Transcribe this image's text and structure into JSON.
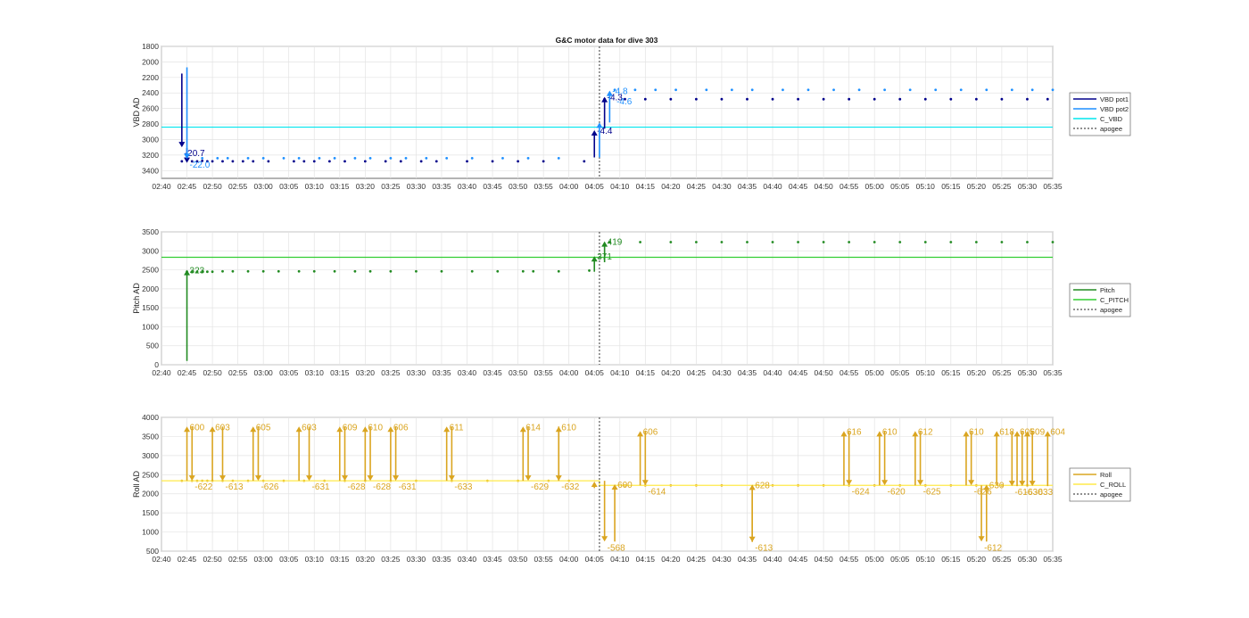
{
  "figure_title": "G&C motor data for dive 303",
  "colors": {
    "vbd_pot1": "#00008b",
    "vbd_pot2": "#1e90ff",
    "c_vbd": "#00e5ee",
    "pitch": "#228b22",
    "c_pitch": "#32cd32",
    "roll": "#daa520",
    "c_roll": "#ffea4a",
    "apogee": "#222222",
    "grid": "#e3e3e3"
  },
  "x_tick_labels": [
    "02:40",
    "02:45",
    "02:50",
    "02:55",
    "03:00",
    "03:05",
    "03:10",
    "03:15",
    "03:20",
    "03:25",
    "03:30",
    "03:35",
    "03:40",
    "03:45",
    "03:50",
    "03:55",
    "04:00",
    "04:05",
    "04:10",
    "04:15",
    "04:20",
    "04:25",
    "04:30",
    "04:35",
    "04:40",
    "04:45",
    "04:50",
    "04:55",
    "05:00",
    "05:05",
    "05:10",
    "05:15",
    "05:20",
    "05:25",
    "05:30",
    "05:35"
  ],
  "chart_data": [
    {
      "type": "line",
      "title": "G&C motor data for dive 303",
      "ylabel": "VBD AD",
      "xlim": [
        "02:40",
        "05:35"
      ],
      "ylim": [
        1800,
        3500
      ],
      "y_reversed": true,
      "yticks": [
        1800,
        2000,
        2200,
        2400,
        2600,
        2800,
        3000,
        3200,
        3400
      ],
      "legend_position": "right",
      "legend": [
        "VBD pot1",
        "VBD pot2",
        "C_VBD",
        "apogee"
      ],
      "series": [
        {
          "name": "VBD pot1",
          "values_x": [
            "02:44",
            "02:46",
            "02:47",
            "02:48",
            "02:49",
            "02:50",
            "02:52",
            "02:54",
            "02:56",
            "02:58",
            "03:01",
            "03:06",
            "03:08",
            "03:10",
            "03:13",
            "03:16",
            "03:20",
            "03:24",
            "03:27",
            "03:31",
            "03:34",
            "03:40",
            "03:45",
            "03:50",
            "03:55",
            "04:03",
            "04:07",
            "04:11",
            "04:15",
            "04:20",
            "04:25",
            "04:30",
            "04:35",
            "04:40",
            "04:45",
            "04:50",
            "04:55",
            "05:00",
            "05:05",
            "05:10",
            "05:15",
            "05:20",
            "05:25",
            "05:30",
            "05:34"
          ],
          "values": [
            3280,
            3280,
            3280,
            3275,
            3280,
            3280,
            3280,
            3280,
            3280,
            3280,
            3280,
            3280,
            3280,
            3280,
            3280,
            3280,
            3280,
            3280,
            3280,
            3280,
            3280,
            3280,
            3280,
            3280,
            3280,
            3280,
            2480,
            2480,
            2480,
            2480,
            2480,
            2480,
            2480,
            2480,
            2480,
            2480,
            2480,
            2480,
            2480,
            2480,
            2480,
            2480,
            2480,
            2480,
            2480
          ]
        },
        {
          "name": "VBD pot2",
          "values_x": [
            "02:45",
            "02:48",
            "02:51",
            "02:53",
            "02:57",
            "03:00",
            "03:04",
            "03:07",
            "03:11",
            "03:14",
            "03:18",
            "03:21",
            "03:25",
            "03:28",
            "03:32",
            "03:36",
            "03:41",
            "03:47",
            "03:52",
            "03:58",
            "04:09",
            "04:13",
            "04:17",
            "04:21",
            "04:27",
            "04:32",
            "04:36",
            "04:42",
            "04:47",
            "04:52",
            "04:57",
            "05:02",
            "05:07",
            "05:12",
            "05:17",
            "05:22",
            "05:27",
            "05:31",
            "05:35"
          ],
          "values": [
            3240,
            3240,
            3240,
            3240,
            3240,
            3240,
            3240,
            3240,
            3240,
            3240,
            3240,
            3240,
            3240,
            3240,
            3240,
            3240,
            3240,
            3240,
            3240,
            3240,
            2360,
            2360,
            2360,
            2360,
            2360,
            2360,
            2360,
            2360,
            2360,
            2360,
            2360,
            2360,
            2360,
            2360,
            2360,
            2360,
            2360,
            2360,
            2360
          ]
        },
        {
          "name": "C_VBD",
          "constant": 2840
        }
      ],
      "arrows": [
        {
          "series": "VBD pot1",
          "x": "02:44",
          "from": 2150,
          "to": 3100,
          "label": "-20.7"
        },
        {
          "series": "VBD pot1",
          "x": "02:45",
          "from": 3110,
          "to": 3300,
          "label": ""
        },
        {
          "series": "VBD pot2",
          "x": "02:45",
          "from": 2070,
          "to": 3250,
          "label": "-22.0"
        },
        {
          "series": "VBD pot1",
          "x": "04:05",
          "from": 3230,
          "to": 2880,
          "label": "-4.4"
        },
        {
          "series": "VBD pot1",
          "x": "04:07",
          "from": 2860,
          "to": 2450,
          "label": "-4.3"
        },
        {
          "series": "VBD pot2",
          "x": "04:06",
          "from": 3230,
          "to": 2780,
          "label": ""
        },
        {
          "series": "VBD pot2",
          "x": "04:08",
          "from": 2780,
          "to": 2370,
          "label": "-4.8"
        }
      ],
      "annotations": [
        {
          "text": "-4.6",
          "x": "04:09",
          "y": 2500
        }
      ],
      "apogee": "04:06"
    },
    {
      "type": "line",
      "ylabel": "Pitch AD",
      "xlim": [
        "02:40",
        "05:35"
      ],
      "ylim": [
        0,
        3500
      ],
      "yticks": [
        0,
        500,
        1000,
        1500,
        2000,
        2500,
        3000,
        3500
      ],
      "legend_position": "right",
      "legend": [
        "Pitch",
        "C_PITCH",
        "apogee"
      ],
      "series": [
        {
          "name": "Pitch",
          "values_x": [
            "02:45",
            "02:46",
            "02:47",
            "02:48",
            "02:49",
            "02:50",
            "02:52",
            "02:54",
            "02:57",
            "03:00",
            "03:03",
            "03:07",
            "03:10",
            "03:14",
            "03:18",
            "03:21",
            "03:25",
            "03:30",
            "03:35",
            "03:41",
            "03:46",
            "03:51",
            "03:53",
            "03:58",
            "04:04",
            "04:08",
            "04:14",
            "04:20",
            "04:25",
            "04:30",
            "04:35",
            "04:40",
            "04:45",
            "04:50",
            "04:55",
            "05:00",
            "05:05",
            "05:10",
            "05:15",
            "05:20",
            "05:25",
            "05:30",
            "05:35"
          ],
          "values": [
            2450,
            2450,
            2450,
            2450,
            2450,
            2450,
            2460,
            2460,
            2460,
            2460,
            2460,
            2460,
            2460,
            2460,
            2460,
            2460,
            2460,
            2460,
            2460,
            2460,
            2460,
            2460,
            2460,
            2460,
            2480,
            3230,
            3230,
            3230,
            3230,
            3230,
            3230,
            3230,
            3230,
            3230,
            3230,
            3230,
            3230,
            3230,
            3230,
            3230,
            3230,
            3230,
            3230
          ]
        },
        {
          "name": "C_PITCH",
          "constant": 2830
        }
      ],
      "arrows": [
        {
          "series": "Pitch",
          "x": "02:45",
          "from": 100,
          "to": 2500,
          "label": "323"
        },
        {
          "series": "Pitch",
          "x": "04:05",
          "from": 2450,
          "to": 2860,
          "label": "371"
        },
        {
          "series": "Pitch",
          "x": "04:07",
          "from": 2700,
          "to": 3250,
          "label": "419"
        }
      ],
      "apogee": "04:06"
    },
    {
      "type": "line",
      "ylabel": "Roll AD",
      "xlim": [
        "02:40",
        "05:35"
      ],
      "ylim": [
        500,
        4000
      ],
      "yticks": [
        500,
        1000,
        1500,
        2000,
        2500,
        3000,
        3500,
        4000
      ],
      "legend_position": "right",
      "legend": [
        "Roll",
        "C_ROLL",
        "apogee"
      ],
      "series": [
        {
          "name": "Roll",
          "values_x": [
            "02:44",
            "02:46",
            "02:47",
            "02:48",
            "02:49",
            "02:50",
            "02:52",
            "02:54",
            "02:57",
            "03:00",
            "03:04",
            "03:08",
            "03:12",
            "03:16",
            "03:20",
            "03:25",
            "03:30",
            "03:37",
            "03:44",
            "03:50",
            "03:56",
            "04:00",
            "04:11",
            "04:15",
            "04:20",
            "04:25",
            "04:30",
            "04:40",
            "04:45",
            "04:50",
            "04:55",
            "05:00",
            "05:05",
            "05:10",
            "05:15",
            "05:20",
            "05:25",
            "05:30"
          ],
          "values": [
            2340,
            2340,
            2340,
            2340,
            2340,
            2340,
            2340,
            2340,
            2340,
            2340,
            2340,
            2340,
            2340,
            2340,
            2340,
            2340,
            2340,
            2340,
            2340,
            2340,
            2340,
            2340,
            2220,
            2220,
            2220,
            2220,
            2220,
            2220,
            2220,
            2220,
            2220,
            2220,
            2220,
            2220,
            2220,
            2220,
            2220,
            2220
          ]
        },
        {
          "name": "C_ROLL",
          "values_x": [
            "02:40",
            "04:06",
            "04:06",
            "05:35"
          ],
          "values": [
            2340,
            2340,
            2220,
            2220
          ]
        }
      ],
      "arrows": [
        {
          "x": "02:45",
          "from": 2340,
          "to": 3760,
          "label": "600"
        },
        {
          "x": "02:46",
          "from": 3760,
          "to": 2340,
          "label": "-622"
        },
        {
          "x": "02:50",
          "from": 2340,
          "to": 3760,
          "label": "603"
        },
        {
          "x": "02:52",
          "from": 3760,
          "to": 2340,
          "label": "-613"
        },
        {
          "x": "02:58",
          "from": 2340,
          "to": 3760,
          "label": "605"
        },
        {
          "x": "02:59",
          "from": 3760,
          "to": 2340,
          "label": "-626"
        },
        {
          "x": "03:07",
          "from": 2340,
          "to": 3760,
          "label": "603"
        },
        {
          "x": "03:09",
          "from": 3760,
          "to": 2340,
          "label": "-631"
        },
        {
          "x": "03:15",
          "from": 2340,
          "to": 3760,
          "label": "609"
        },
        {
          "x": "03:16",
          "from": 3760,
          "to": 2340,
          "label": "-628"
        },
        {
          "x": "03:20",
          "from": 2340,
          "to": 3760,
          "label": "610"
        },
        {
          "x": "03:21",
          "from": 3760,
          "to": 2340,
          "label": "-628"
        },
        {
          "x": "03:25",
          "from": 2340,
          "to": 3760,
          "label": "606"
        },
        {
          "x": "03:26",
          "from": 3760,
          "to": 2340,
          "label": "-631"
        },
        {
          "x": "03:36",
          "from": 2340,
          "to": 3760,
          "label": "611"
        },
        {
          "x": "03:37",
          "from": 3760,
          "to": 2340,
          "label": "-633"
        },
        {
          "x": "03:51",
          "from": 2340,
          "to": 3760,
          "label": "614"
        },
        {
          "x": "03:52",
          "from": 3760,
          "to": 2340,
          "label": "-629"
        },
        {
          "x": "03:58",
          "from": 2340,
          "to": 3760,
          "label": "610"
        },
        {
          "x": "03:58",
          "from": 3760,
          "to": 2340,
          "label": "-632"
        },
        {
          "x": "04:05",
          "from": 2150,
          "to": 2320,
          "label": ""
        },
        {
          "x": "04:07",
          "from": 2340,
          "to": 750,
          "label": "-568"
        },
        {
          "x": "04:09",
          "from": 750,
          "to": 2250,
          "label": "600"
        },
        {
          "x": "04:14",
          "from": 2220,
          "to": 3640,
          "label": "606"
        },
        {
          "x": "04:15",
          "from": 3640,
          "to": 2220,
          "label": "-614"
        },
        {
          "x": "04:36",
          "from": 2220,
          "to": 740,
          "label": "-613"
        },
        {
          "x": "04:36",
          "from": 740,
          "to": 2240,
          "label": "628"
        },
        {
          "x": "04:54",
          "from": 2220,
          "to": 3640,
          "label": "616"
        },
        {
          "x": "04:55",
          "from": 3640,
          "to": 2220,
          "label": "-624"
        },
        {
          "x": "05:01",
          "from": 2220,
          "to": 3640,
          "label": "610"
        },
        {
          "x": "05:02",
          "from": 3640,
          "to": 2220,
          "label": "-620"
        },
        {
          "x": "05:08",
          "from": 2220,
          "to": 3640,
          "label": "612"
        },
        {
          "x": "05:09",
          "from": 3640,
          "to": 2220,
          "label": "-625"
        },
        {
          "x": "05:18",
          "from": 2220,
          "to": 3640,
          "label": "610"
        },
        {
          "x": "05:19",
          "from": 3640,
          "to": 2220,
          "label": "-626"
        },
        {
          "x": "05:21",
          "from": 2220,
          "to": 750,
          "label": "-612"
        },
        {
          "x": "05:22",
          "from": 750,
          "to": 2240,
          "label": "630"
        },
        {
          "x": "05:24",
          "from": 2220,
          "to": 3640,
          "label": "618"
        },
        {
          "x": "05:27",
          "from": 3640,
          "to": 2200,
          "label": "-616"
        },
        {
          "x": "05:28",
          "from": 2200,
          "to": 3640,
          "label": "605"
        },
        {
          "x": "05:29",
          "from": 3640,
          "to": 2200,
          "label": "-630"
        },
        {
          "x": "05:30",
          "from": 2200,
          "to": 3640,
          "label": "609"
        },
        {
          "x": "05:31",
          "from": 3640,
          "to": 2200,
          "label": "-633"
        },
        {
          "x": "05:34",
          "from": 2200,
          "to": 3640,
          "label": "604"
        }
      ],
      "apogee": "04:06"
    }
  ]
}
